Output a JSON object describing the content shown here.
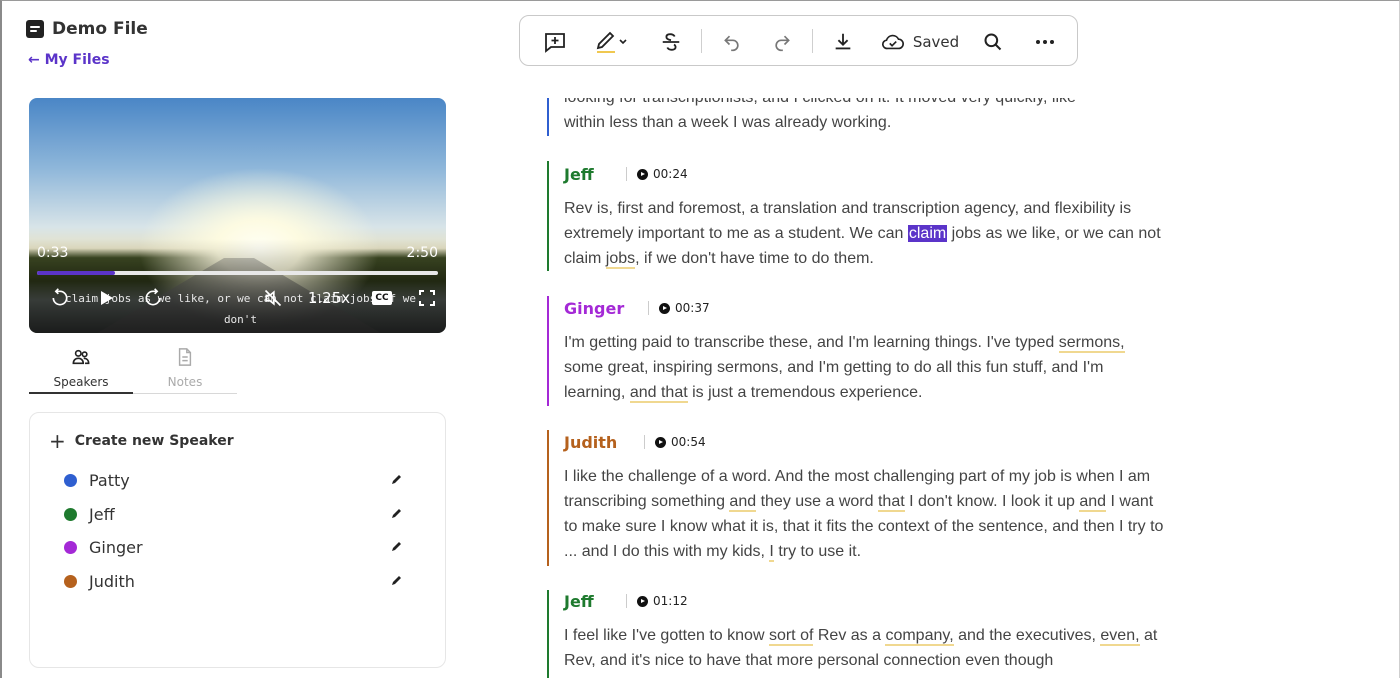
{
  "header": {
    "file_title": "Demo File",
    "back_label": "← My Files"
  },
  "toolbar": {
    "saved_label": "Saved"
  },
  "player": {
    "current_time": "0:33",
    "duration": "2:50",
    "progress_fraction": 0.194,
    "caption_line1": "claim jobs as we like, or we can not claim jobs if we",
    "caption_line2": "don't",
    "rate": "1.25x",
    "cc": "CC"
  },
  "tabs": [
    {
      "label": "Speakers",
      "active": true
    },
    {
      "label": "Notes",
      "active": false
    }
  ],
  "speakers_panel": {
    "create_label": "Create new Speaker",
    "speakers": [
      {
        "name": "Patty",
        "color": "#2f5fd0"
      },
      {
        "name": "Jeff",
        "color": "#1e7a2e"
      },
      {
        "name": "Ginger",
        "color": "#a429d6"
      },
      {
        "name": "Judith",
        "color": "#b5611d"
      }
    ]
  },
  "colors": {
    "accent": "#5b34c9",
    "jeff": "#1e7a2e",
    "ginger": "#a429d6",
    "judith": "#b5611d",
    "patty": "#2f5fd0"
  },
  "transcript": {
    "partial_top_line1": "looking for transcriptionists, and I clicked on it. It moved very quickly, like",
    "partial_top_line2": "within less than a week I was already working.",
    "blocks": [
      {
        "speaker": "Jeff",
        "time": "00:24",
        "text": "Rev is, first and foremost, a translation and transcription agency, and flexibility is extremely important to me as a student. We can claim jobs as we like, or we can not claim jobs, if we don't have time to do them."
      },
      {
        "speaker": "Ginger",
        "time": "00:37",
        "text": "I'm getting paid to transcribe these, and I'm learning things. I've typed sermons, some great, inspiring sermons, and I'm getting to do all this fun stuff, and I'm learning, and that is just a tremendous experience."
      },
      {
        "speaker": "Judith",
        "time": "00:54",
        "text": "I like the challenge of a word. And the most challenging part of my job is when I am transcribing something and they use a word that I don't know. I look it up and I want to make sure I know what it is, that it fits the context of the sentence, and then I try to ... and I do this with my kids, I try to use it."
      },
      {
        "speaker": "Jeff",
        "time": "01:12",
        "text": "I feel like I've gotten to know sort of Rev as a company, and the executives, even, at Rev, and it's nice to have that more personal connection even though"
      }
    ]
  }
}
